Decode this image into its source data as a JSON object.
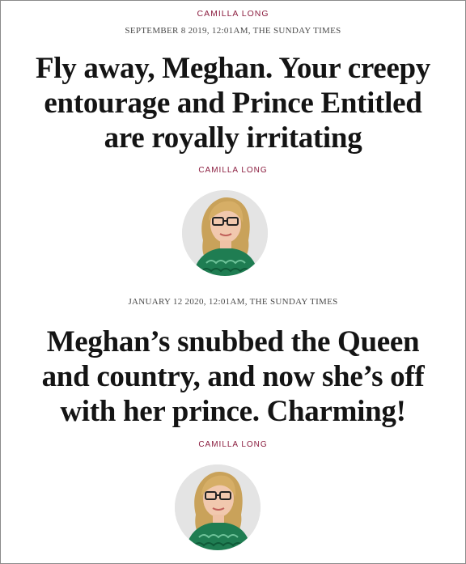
{
  "top_byline": "CAMILLA LONG",
  "articles": [
    {
      "meta": "SEPTEMBER 8 2019, 12:01AM, THE SUNDAY TIMES",
      "headline_lines": [
        "Fly away, Meghan. Your creepy",
        "entourage and Prince Entitled",
        "are royally irritating"
      ],
      "author": "CAMILLA LONG",
      "avatar_icon": "author-portrait"
    },
    {
      "meta": "JANUARY 12 2020, 12:01AM, THE SUNDAY TIMES",
      "headline_lines": [
        "Meghan’s snubbed the Queen",
        "and country, and now she’s off",
        "with her prince. Charming!"
      ],
      "author": "CAMILLA LONG",
      "avatar_icon": "author-portrait"
    }
  ],
  "colors": {
    "accent": "#8b1d3f",
    "headline": "#141414",
    "meta": "#4a4a4a"
  }
}
